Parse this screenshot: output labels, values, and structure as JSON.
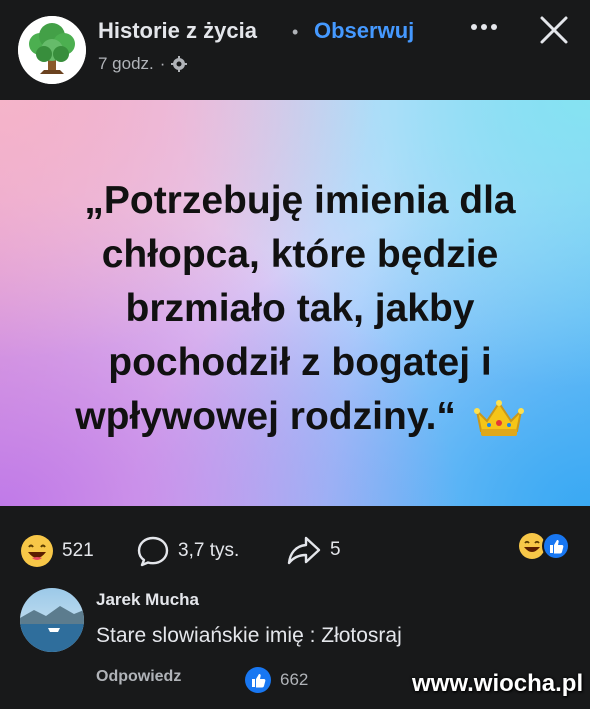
{
  "header": {
    "page_name": "Historie z życia",
    "separator": "•",
    "follow_label": "Obserwuj",
    "time": "7 godz.",
    "time_separator": "·",
    "more_icon": "more-horizontal-icon",
    "close_icon": "close-icon"
  },
  "post": {
    "quote_lines": [
      "„Potrzebuję imienia dla",
      "chłopca, które będzie",
      "brzmiało tak, jakby",
      "pochodził z bogatej i",
      "wpływowej rodziny.“"
    ],
    "emoji": "crown-icon"
  },
  "stats": {
    "reactions_count": "521",
    "comments_count": "3,7 tys.",
    "shares_count": "5"
  },
  "comment": {
    "author": "Jarek Mucha",
    "text": "Stare slowiańskie imię : Złotosraj",
    "reply_label": "Odpowiedz",
    "likes_count": "662"
  },
  "watermark": "www.wiocha.pl",
  "colors": {
    "background": "#18191a",
    "accent": "#4599ff",
    "text": "#e4e6eb",
    "muted": "#b0b3b8"
  }
}
